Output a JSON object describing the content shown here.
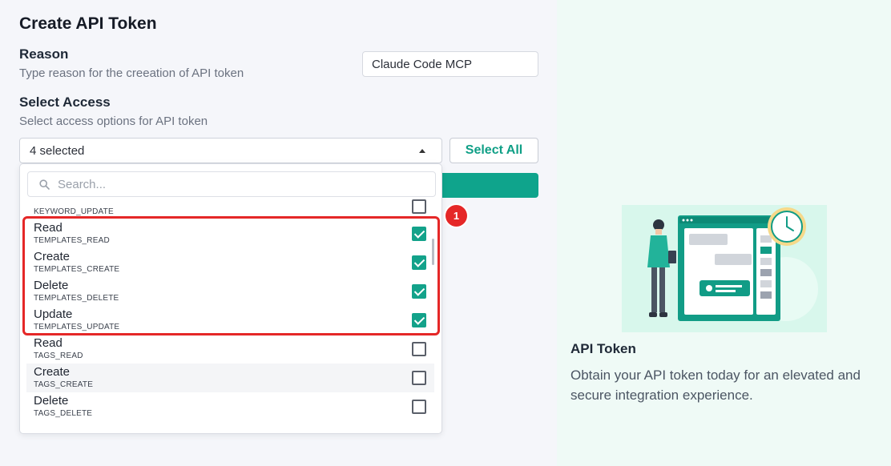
{
  "page": {
    "title": "Create API Token"
  },
  "reason": {
    "title": "Reason",
    "subtitle": "Type reason for the creeation of API token",
    "value": "Claude Code MCP"
  },
  "access": {
    "title": "Select Access",
    "subtitle": "Select access options for API token",
    "selected_text": "4 selected",
    "select_all_label": "Select All",
    "search_placeholder": "Search...",
    "options": [
      {
        "label": "",
        "code": "KEYWORD_UPDATE",
        "checked": false
      },
      {
        "label": "Read",
        "code": "TEMPLATES_READ",
        "checked": true
      },
      {
        "label": "Create",
        "code": "TEMPLATES_CREATE",
        "checked": true
      },
      {
        "label": "Delete",
        "code": "TEMPLATES_DELETE",
        "checked": true
      },
      {
        "label": "Update",
        "code": "TEMPLATES_UPDATE",
        "checked": true
      },
      {
        "label": "Read",
        "code": "TAGS_READ",
        "checked": false
      },
      {
        "label": "Create",
        "code": "TAGS_CREATE",
        "checked": false
      },
      {
        "label": "Delete",
        "code": "TAGS_DELETE",
        "checked": false
      }
    ]
  },
  "annotation": {
    "marker": "1"
  },
  "info": {
    "title": "API Token",
    "description": "Obtain your API token today for an elevated and secure integration experience."
  },
  "colors": {
    "accent": "#13a28a",
    "highlight": "#e52727",
    "illustration_bg": "#d8f7ec"
  }
}
